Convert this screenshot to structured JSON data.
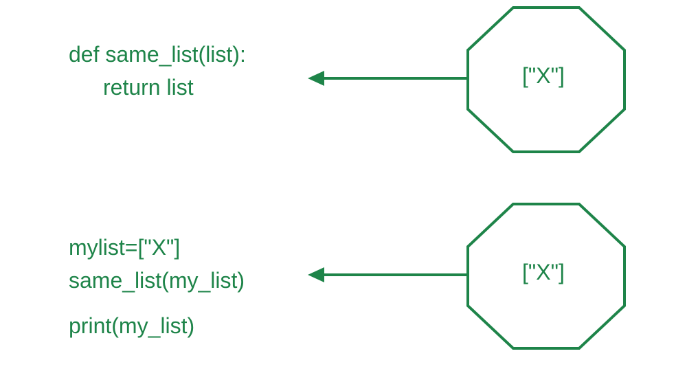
{
  "colors": {
    "green": "#1e8449"
  },
  "top": {
    "code": {
      "line1": "def same_list(list):",
      "line2": "return list"
    },
    "octagon_label": "[\"X\"]"
  },
  "bottom": {
    "code": {
      "line1": "mylist=[\"X\"]",
      "line2": "same_list(my_list)",
      "line3": "print(my_list)"
    },
    "octagon_label": "[\"X\"]"
  }
}
